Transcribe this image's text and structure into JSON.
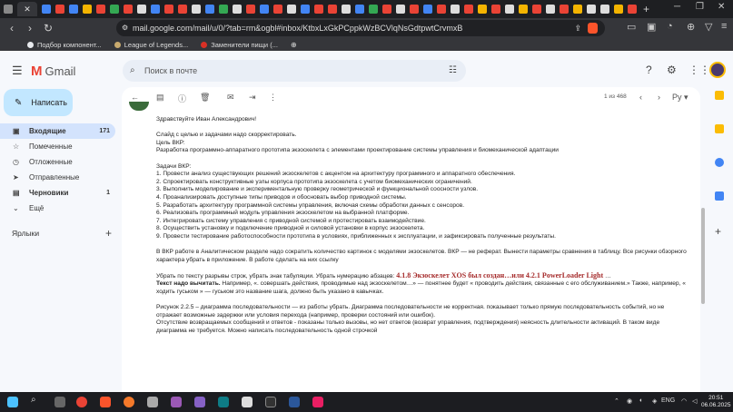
{
  "browser": {
    "url": "mail.google.com/mail/u/0/?tab=rm&ogbl#inbox/KtbxLxGkPCppkWzBCVlqNsGdtpwtCrvmxB",
    "active_tab_close": "✕",
    "new_tab": "+",
    "bookmarks": [
      {
        "label": "Подбор компонент...",
        "color": "#e8eaed"
      },
      {
        "label": "League of Legends...",
        "color": "#c8aa6e"
      },
      {
        "label": "Заменители пищи (...",
        "color": "#d93025"
      }
    ]
  },
  "gmail": {
    "brand": "Gmail",
    "search_placeholder": "Поиск в почте",
    "compose_label": "Написать",
    "nav": [
      {
        "label": "Входящие",
        "count": "171",
        "icon": "inbox-icon",
        "glyph": "▣",
        "active": true
      },
      {
        "label": "Помеченные",
        "count": "",
        "icon": "star-icon",
        "glyph": "☆",
        "active": false
      },
      {
        "label": "Отложенные",
        "count": "",
        "icon": "clock-icon",
        "glyph": "◷",
        "active": false
      },
      {
        "label": "Отправленные",
        "count": "",
        "icon": "send-icon",
        "glyph": "➤",
        "active": false
      },
      {
        "label": "Черновики",
        "count": "1",
        "icon": "draft-icon",
        "glyph": "▤",
        "active": false
      },
      {
        "label": "Ещё",
        "count": "",
        "icon": "chevron-down-icon",
        "glyph": "⌄",
        "active": false
      }
    ],
    "labels_heading": "Ярлыки",
    "pager_text": "1 из 468",
    "language_indicator": "Ру"
  },
  "email": {
    "greeting": "Здравствуйте Иван Александрович!",
    "intro": "Слайд с целью и задачами надо скорректировать.",
    "goal_label": "Цель ВКР:",
    "goal_text": "Разработка программно-аппаратного прототипа экзоскелета с элементами проектирование системы управления и биомеханической адаптации",
    "tasks_label": "Задачи ВКР:",
    "tasks": [
      "1. Провести анализ существующих решений экзоскелетов с акцентом на архитектуру программного и аппаратного обеспечения.",
      "2. Спроектировать конструктивные узлы корпуса прототипа экзоскелета с учетом биомеханических ограничений.",
      "3. Выполнить моделирование и экспериментальную проверку геометрической и функциональной соосности узлов.",
      "4. Проанализировать доступные типы приводов и обосновать выбор приводной системы.",
      "5. Разработать архитектуру программной системы управления, включая схемы обработки данных с сенсоров.",
      "6. Реализовать программный модуль управления экзоскелетом на выбранной платформе.",
      "7. Интегрировать систему управления с приводной системой и протестировать взаимодействие.",
      "8. Осуществить установку и подключение приводной и силовой установки в корпус экзоскелета.",
      "9. Провести тестирование работоспособности прототипа в условиях, приближенных к эксплуатации, и зафиксировать полученные результаты."
    ],
    "para_vkr": "В ВКР работе в Аналитическом разделе надо сократить количество картинок с моделями экзоскелетов. ВКР — не реферат. Вынести параметры сравнения в таблицу. Все рисунки обзорного характера убрать в приложение. В работе сделать на них ссылку",
    "para_breaks_prefix": "Убрать по тексту разрывы строк, убрать знак табуляции.  Убрать нумерацию абзацев: ",
    "para_breaks_quote1": "4.1.8 Экзоскелет XOS был создан…или 4.2.1 PowerLoader Light",
    "para_breaks_ellipsis": " …",
    "para_subtract_bold": "Текст надо вычитать.",
    "para_subtract_text": " Например, «. совершать действия, проводимые над экзоскелетом…» — понятнее будет « проводить действия, связанные с его обслуживанием.» Также, например, «   ходить гуськом    » — гуськом это название шага, должно быть указано в кавычках.",
    "para_fig": "Рисунок 2.2.5 – диаграмма последовательности — из работы убрать. Диаграмма последовательности не корректная. показывает только прямую последовательность событий, но не отражает возможные задержки или условия перехода (например, проверки состояний или ошибок).",
    "para_fig2": "Отсутствие возвращаемых сообщений и ответов - показаны только вызовы, но нет ответов (возврат управления, подтверждения)  неясность длительности активаций. В таком виде диаграмма не требуется. Можно написать последовательность одной строчкой"
  },
  "taskbar": {
    "lang": "ENG",
    "time": "20:51",
    "date": "06.06.2025"
  },
  "colors": {
    "accent": "#c2e7ff",
    "active_nav": "#d3e3fd",
    "gmail_red": "#ea4335"
  }
}
